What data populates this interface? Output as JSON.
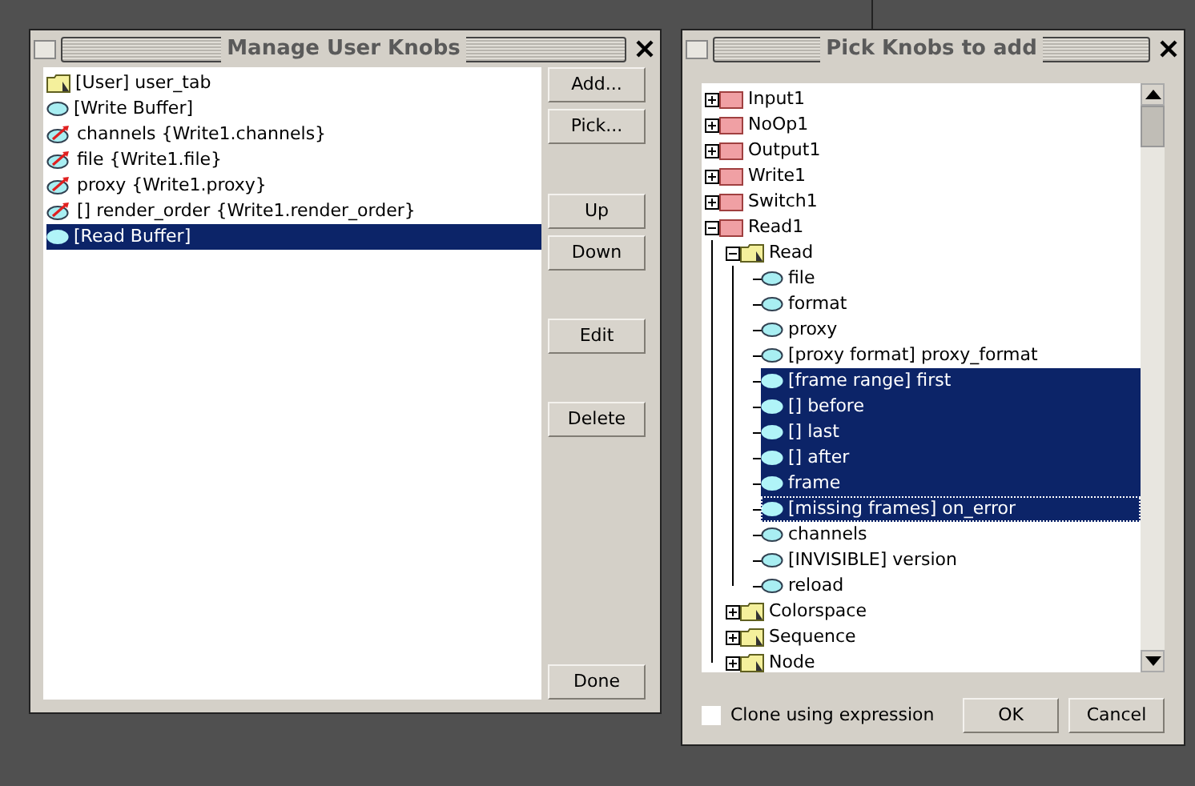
{
  "manage_window": {
    "title": "Manage User Knobs",
    "items": [
      {
        "kind": "tab",
        "label": "[User] user_tab",
        "selected": false
      },
      {
        "kind": "knob",
        "label": "[Write Buffer]",
        "selected": false
      },
      {
        "kind": "linked",
        "label": "channels {Write1.channels}",
        "selected": false
      },
      {
        "kind": "linked",
        "label": "file {Write1.file}",
        "selected": false
      },
      {
        "kind": "linked",
        "label": "proxy {Write1.proxy}",
        "selected": false
      },
      {
        "kind": "linked",
        "label": "[] render_order {Write1.render_order}",
        "selected": false
      },
      {
        "kind": "knob",
        "label": "[Read Buffer]",
        "selected": true
      }
    ],
    "buttons": [
      "Add...",
      "Pick...",
      "Up",
      "Down",
      "Edit",
      "Delete",
      "Done"
    ]
  },
  "pick_window": {
    "title": "Pick Knobs to add",
    "tree": [
      {
        "kind": "node",
        "label": "Input1",
        "expanded": false,
        "selected": false
      },
      {
        "kind": "node",
        "label": "NoOp1",
        "expanded": false,
        "selected": false
      },
      {
        "kind": "node",
        "label": "Output1",
        "expanded": false,
        "selected": false
      },
      {
        "kind": "node",
        "label": "Write1",
        "expanded": false,
        "selected": false
      },
      {
        "kind": "node",
        "label": "Switch1",
        "expanded": false,
        "selected": false
      },
      {
        "kind": "node",
        "label": "Read1",
        "expanded": true,
        "selected": false,
        "children": [
          {
            "kind": "folder",
            "label": "Read",
            "expanded": true,
            "selected": false,
            "children": [
              {
                "kind": "knob",
                "label": "file",
                "selected": false
              },
              {
                "kind": "knob",
                "label": "format",
                "selected": false
              },
              {
                "kind": "knob",
                "label": "proxy",
                "selected": false
              },
              {
                "kind": "knob",
                "label": "[proxy format] proxy_format",
                "selected": false
              },
              {
                "kind": "knob",
                "label": "[frame range] first",
                "selected": true
              },
              {
                "kind": "knob",
                "label": "[] before",
                "selected": true
              },
              {
                "kind": "knob",
                "label": "[] last",
                "selected": true
              },
              {
                "kind": "knob",
                "label": "[] after",
                "selected": true
              },
              {
                "kind": "knob",
                "label": "frame",
                "selected": true
              },
              {
                "kind": "knob",
                "label": "[missing frames] on_error",
                "selected": true,
                "focused": true
              },
              {
                "kind": "knob",
                "label": "channels",
                "selected": false
              },
              {
                "kind": "knob",
                "label": "[INVISIBLE] version",
                "selected": false
              },
              {
                "kind": "knob",
                "label": "reload",
                "selected": false
              }
            ]
          },
          {
            "kind": "folder",
            "label": "Colorspace",
            "expanded": false,
            "selected": false
          },
          {
            "kind": "folder",
            "label": "Sequence",
            "expanded": false,
            "selected": false
          },
          {
            "kind": "folder",
            "label": "Node",
            "expanded": false,
            "selected": false
          }
        ]
      }
    ],
    "clone_checkbox": {
      "label": "Clone using expression",
      "checked": false
    },
    "buttons": [
      "OK",
      "Cancel"
    ]
  }
}
